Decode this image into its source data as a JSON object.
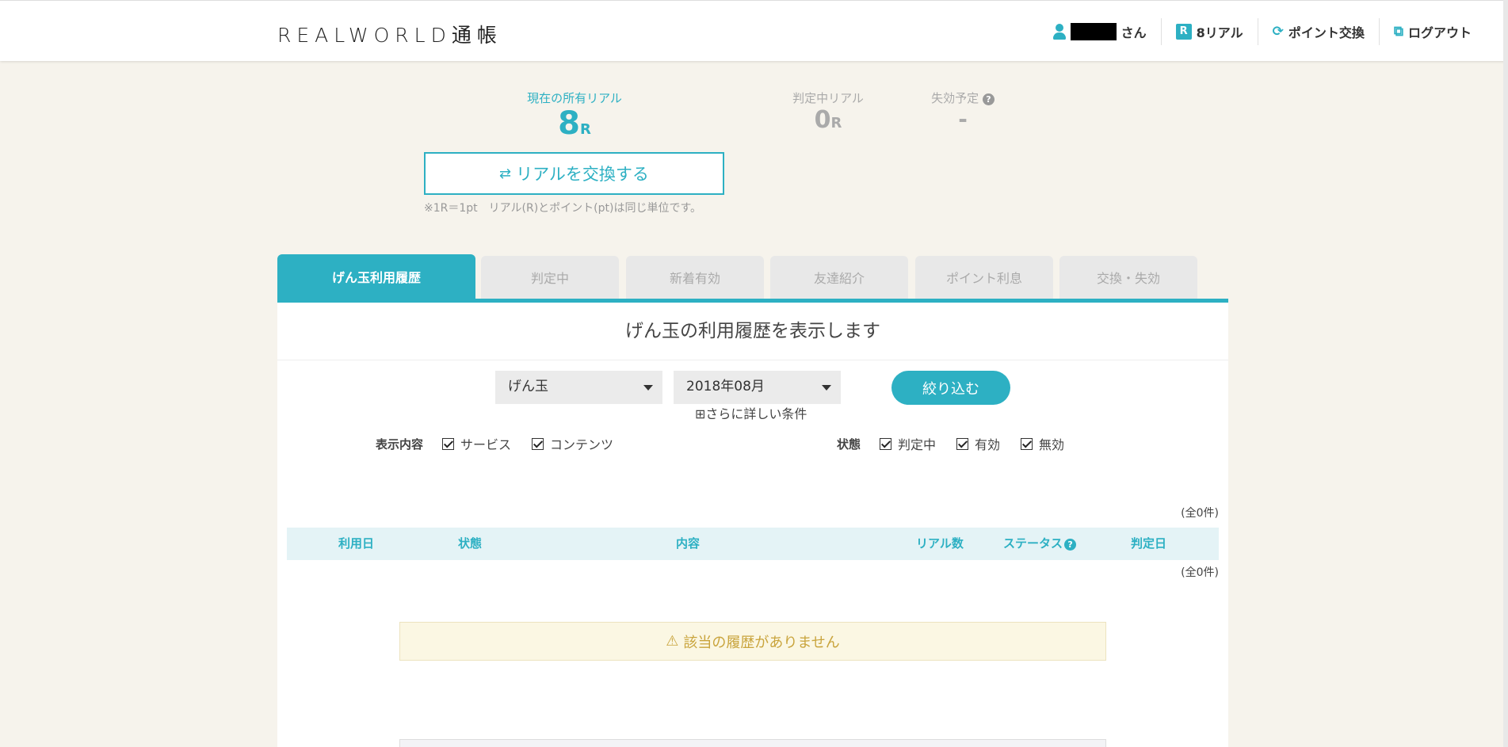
{
  "header": {
    "logo": "REALWORLD通帳",
    "user_suffix": "さん",
    "real_count": "8リアル",
    "point_exchange": "ポイント交換",
    "logout": "ログアウト"
  },
  "balance": {
    "current_label": "現在の所有リアル",
    "current_value": "8",
    "current_unit": "R",
    "pending_label": "判定中リアル",
    "pending_value": "0",
    "pending_unit": "R",
    "expire_label": "失効予定",
    "expire_value": "-",
    "exchange_button": "リアルを交換する",
    "note": "※1R＝1pt　リアル(R)とポイント(pt)は同じ単位です。"
  },
  "tabs": [
    {
      "label": "げん玉利用履歴"
    },
    {
      "label": "判定中"
    },
    {
      "label": "新着有効"
    },
    {
      "label": "友達紹介"
    },
    {
      "label": "ポイント利息"
    },
    {
      "label": "交換・失効"
    }
  ],
  "panel": {
    "title": "げん玉の利用履歴を表示します",
    "service_select": "げん玉",
    "month_select": "2018年08月",
    "filter_button": "絞り込む",
    "more_conditions": "⊞さらに詳しい条件",
    "display_label": "表示内容",
    "display_options": [
      "サービス",
      "コンテンツ"
    ],
    "status_label": "状態",
    "status_options": [
      "判定中",
      "有効",
      "無効"
    ],
    "count_top": "(全0件)",
    "count_bottom": "(全0件)",
    "columns": [
      "利用日",
      "状態",
      "内容",
      "リアル数",
      "ステータス",
      "判定日"
    ],
    "empty_message": "該当の履歴がありません"
  },
  "colors": {
    "accent": "#2db0c3",
    "background": "#f6f3ec",
    "warning_bg": "#fbf7e3",
    "warning_text": "#c9a43c"
  }
}
